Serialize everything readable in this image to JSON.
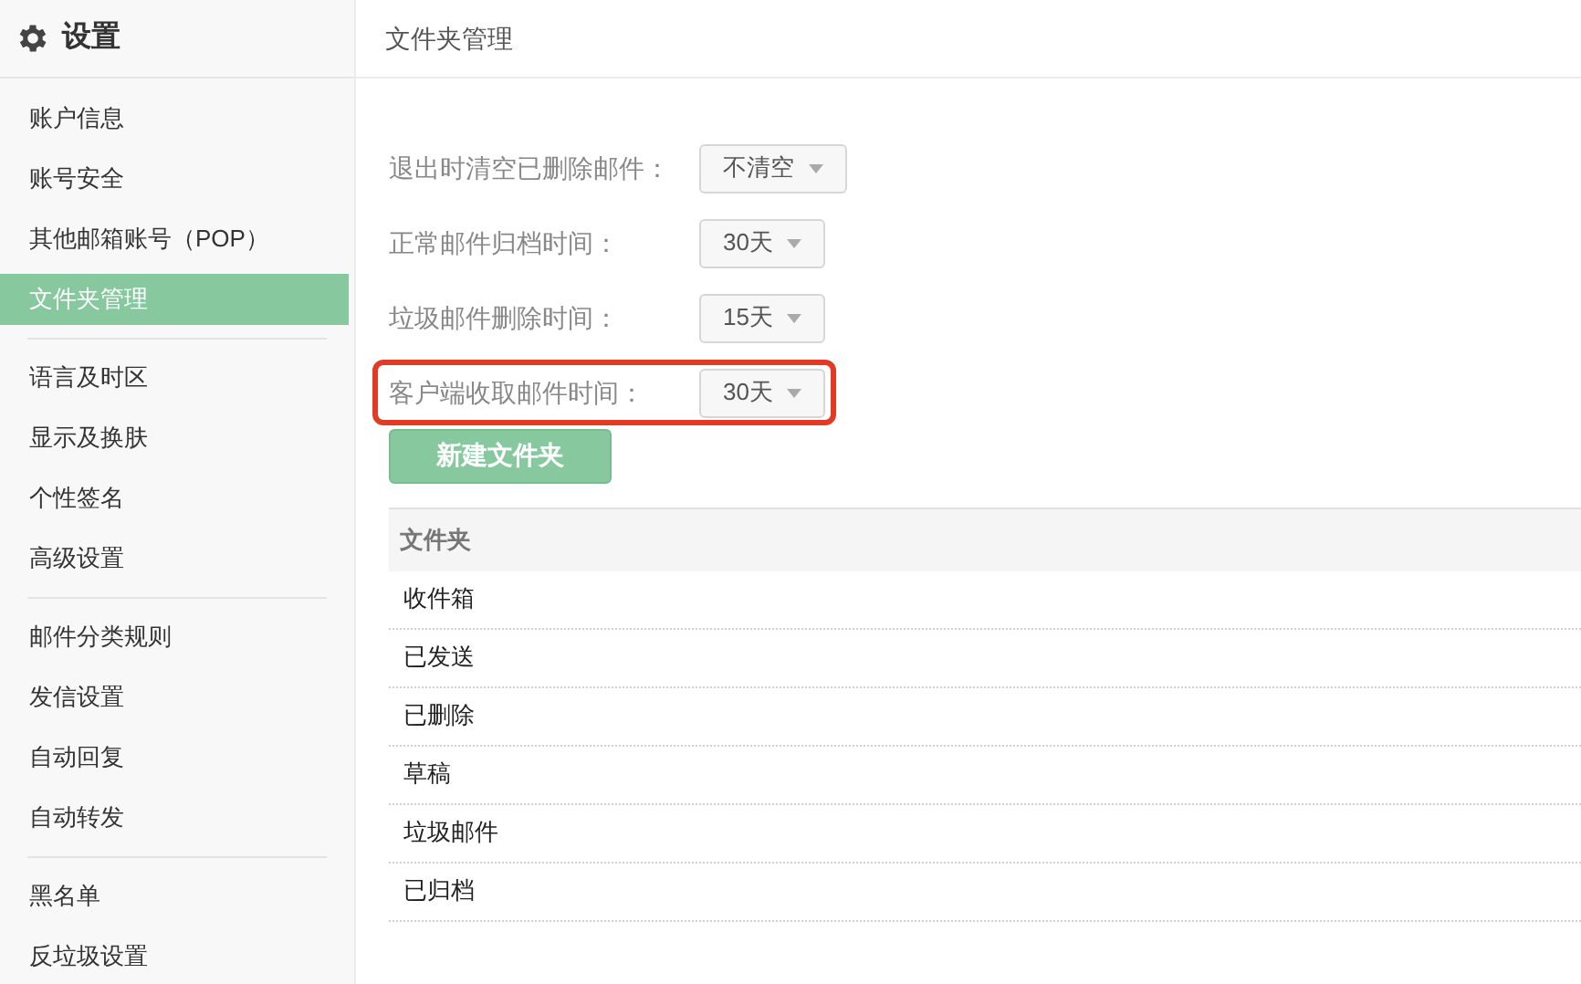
{
  "sidebar": {
    "title": "设置",
    "groups": [
      {
        "items": [
          {
            "label": "账户信息",
            "selected": false
          },
          {
            "label": "账号安全",
            "selected": false
          },
          {
            "label": "其他邮箱账号（POP）",
            "selected": false
          },
          {
            "label": "文件夹管理",
            "selected": true
          }
        ]
      },
      {
        "items": [
          {
            "label": "语言及时区",
            "selected": false
          },
          {
            "label": "显示及换肤",
            "selected": false
          },
          {
            "label": "个性签名",
            "selected": false
          },
          {
            "label": "高级设置",
            "selected": false
          }
        ]
      },
      {
        "items": [
          {
            "label": "邮件分类规则",
            "selected": false
          },
          {
            "label": "发信设置",
            "selected": false
          },
          {
            "label": "自动回复",
            "selected": false
          },
          {
            "label": "自动转发",
            "selected": false
          }
        ]
      },
      {
        "items": [
          {
            "label": "黑名单",
            "selected": false
          },
          {
            "label": "反垃圾设置",
            "selected": false
          }
        ]
      }
    ]
  },
  "main": {
    "title": "文件夹管理",
    "settings": [
      {
        "label": "退出时清空已删除邮件：",
        "value": "不清空",
        "highlighted": false
      },
      {
        "label": "正常邮件归档时间：",
        "value": "30天",
        "highlighted": false
      },
      {
        "label": "垃圾邮件删除时间：",
        "value": "15天",
        "highlighted": false
      },
      {
        "label": "客户端收取邮件时间：",
        "value": "30天",
        "highlighted": true
      }
    ],
    "new_folder_button": "新建文件夹",
    "table": {
      "columns": [
        "文件夹"
      ],
      "rows": [
        "收件箱",
        "已发送",
        "已删除",
        "草稿",
        "垃圾邮件",
        "已归档"
      ]
    }
  }
}
